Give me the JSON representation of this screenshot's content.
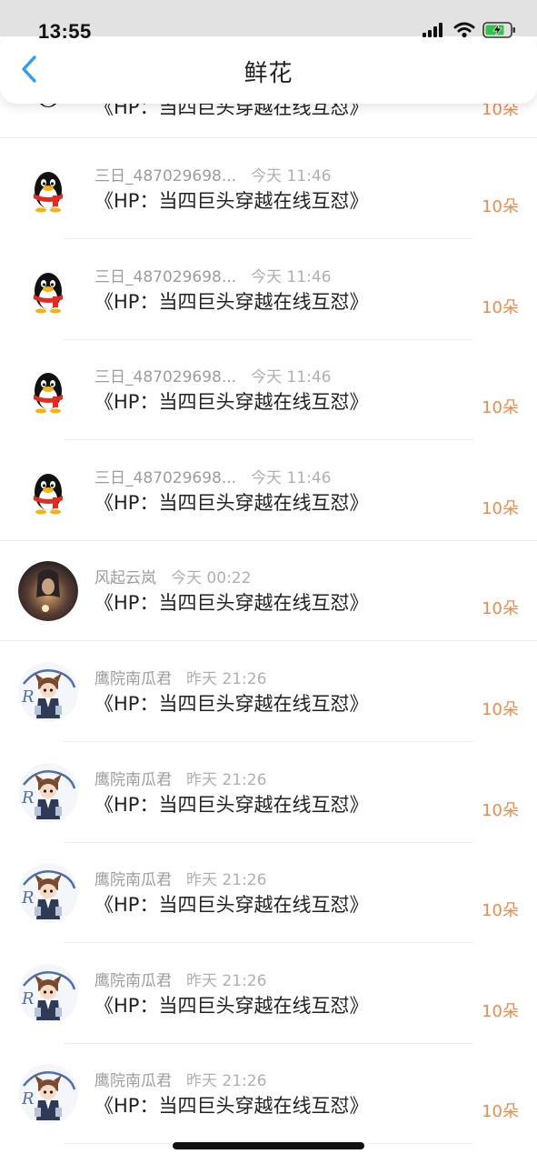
{
  "status_bar": {
    "time": "13:55"
  },
  "header": {
    "title": "鲜花",
    "back_icon": "chevron-left-icon"
  },
  "colors": {
    "accent_blue": "#2f9df1",
    "flower_orange": "#f18a4a",
    "meta_gray": "#9c9c9c"
  },
  "list": {
    "partial_top": {
      "title": "《HP：当四巨头穿越在线互怼》",
      "count": "10朵"
    },
    "items": [
      {
        "avatar": "qq-penguin",
        "user": "三日_487029698...",
        "time": "今天 11:46",
        "title": "《HP：当四巨头穿越在线互怼》",
        "count": "10朵"
      },
      {
        "avatar": "qq-penguin",
        "user": "三日_487029698...",
        "time": "今天 11:46",
        "title": "《HP：当四巨头穿越在线互怼》",
        "count": "10朵"
      },
      {
        "avatar": "qq-penguin",
        "user": "三日_487029698...",
        "time": "今天 11:46",
        "title": "《HP：当四巨头穿越在线互怼》",
        "count": "10朵"
      },
      {
        "avatar": "qq-penguin",
        "user": "三日_487029698...",
        "time": "今天 11:46",
        "title": "《HP：当四巨头穿越在线互怼》",
        "count": "10朵"
      },
      {
        "avatar": "dark-portrait",
        "user": "风起云岚",
        "time": "今天 00:22",
        "title": "《HP：当四巨头穿越在线互怼》",
        "count": "10朵"
      },
      {
        "avatar": "anime-boy",
        "user": "鹰院南瓜君",
        "time": "昨天 21:26",
        "title": "《HP：当四巨头穿越在线互怼》",
        "count": "10朵"
      },
      {
        "avatar": "anime-boy",
        "user": "鹰院南瓜君",
        "time": "昨天 21:26",
        "title": "《HP：当四巨头穿越在线互怼》",
        "count": "10朵"
      },
      {
        "avatar": "anime-boy",
        "user": "鹰院南瓜君",
        "time": "昨天 21:26",
        "title": "《HP：当四巨头穿越在线互怼》",
        "count": "10朵"
      },
      {
        "avatar": "anime-boy",
        "user": "鹰院南瓜君",
        "time": "昨天 21:26",
        "title": "《HP：当四巨头穿越在线互怼》",
        "count": "10朵"
      },
      {
        "avatar": "anime-boy",
        "user": "鹰院南瓜君",
        "time": "昨天 21:26",
        "title": "《HP：当四巨头穿越在线互怼》",
        "count": "10朵"
      }
    ]
  }
}
